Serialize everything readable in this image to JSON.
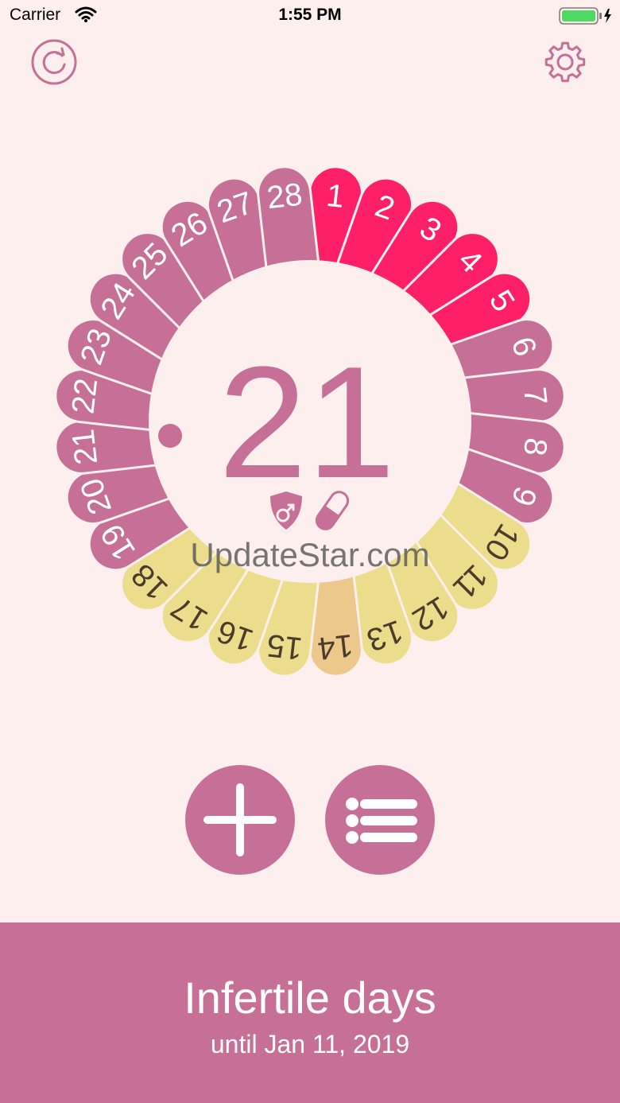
{
  "status_bar": {
    "carrier": "Carrier",
    "time": "1:55 PM"
  },
  "top_bar": {
    "refresh_icon": "refresh-icon",
    "settings_icon": "gear-icon"
  },
  "cycle": {
    "current_day": "21",
    "days": [
      {
        "label": "1",
        "kind": "period"
      },
      {
        "label": "2",
        "kind": "period"
      },
      {
        "label": "3",
        "kind": "period"
      },
      {
        "label": "4",
        "kind": "period"
      },
      {
        "label": "5",
        "kind": "period"
      },
      {
        "label": "6",
        "kind": "infertile"
      },
      {
        "label": "7",
        "kind": "infertile"
      },
      {
        "label": "8",
        "kind": "infertile"
      },
      {
        "label": "9",
        "kind": "infertile"
      },
      {
        "label": "10",
        "kind": "fertile"
      },
      {
        "label": "11",
        "kind": "fertile"
      },
      {
        "label": "12",
        "kind": "fertile"
      },
      {
        "label": "13",
        "kind": "fertile"
      },
      {
        "label": "14",
        "kind": "ovulation"
      },
      {
        "label": "15",
        "kind": "fertile"
      },
      {
        "label": "16",
        "kind": "fertile"
      },
      {
        "label": "17",
        "kind": "fertile"
      },
      {
        "label": "18",
        "kind": "fertile"
      },
      {
        "label": "19",
        "kind": "infertile"
      },
      {
        "label": "20",
        "kind": "infertile"
      },
      {
        "label": "21",
        "kind": "infertile"
      },
      {
        "label": "22",
        "kind": "infertile"
      },
      {
        "label": "23",
        "kind": "infertile"
      },
      {
        "label": "24",
        "kind": "infertile"
      },
      {
        "label": "25",
        "kind": "infertile"
      },
      {
        "label": "26",
        "kind": "infertile"
      },
      {
        "label": "27",
        "kind": "infertile"
      },
      {
        "label": "28",
        "kind": "infertile"
      }
    ],
    "colors": {
      "period": "#fd1f68",
      "infertile": "#c66f97",
      "fertile": "#ecdd8c",
      "ovulation": "#ecc88c",
      "text_light": "#ffffff",
      "text_dark": "#4a3b2b",
      "center_bg": "#fcefee"
    },
    "status_icons": [
      "protection-shield-icon",
      "pill-icon"
    ]
  },
  "watermark": "UpdateStar.com",
  "actions": {
    "add_icon": "plus-icon",
    "list_icon": "list-icon"
  },
  "footer": {
    "title": "Infertile days",
    "subtitle": "until Jan 11, 2019"
  }
}
